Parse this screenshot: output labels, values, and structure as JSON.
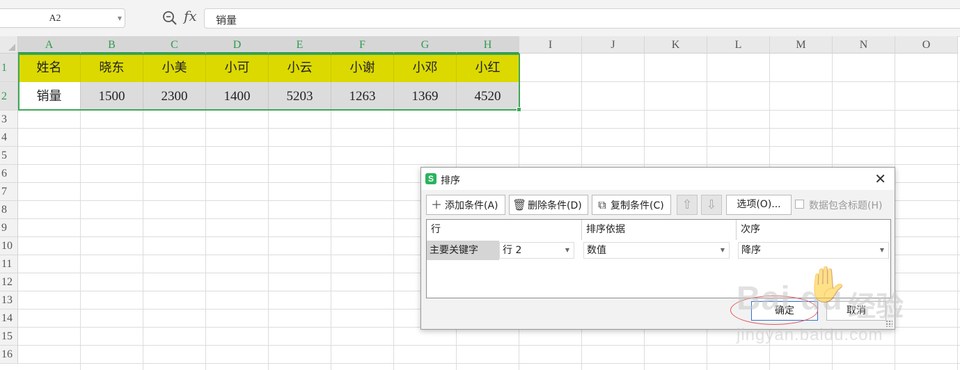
{
  "formula_bar": {
    "name_box": "A2",
    "fx_label": "fx",
    "formula_value": "销量"
  },
  "grid": {
    "columns": [
      "A",
      "B",
      "C",
      "D",
      "E",
      "F",
      "G",
      "H",
      "I",
      "J",
      "K",
      "L",
      "M",
      "N",
      "O"
    ],
    "rows": [
      "1",
      "2",
      "3",
      "4",
      "5",
      "6",
      "7",
      "8",
      "9",
      "10",
      "11",
      "12",
      "13",
      "14",
      "15",
      "16"
    ],
    "row1": [
      "姓名",
      "晓东",
      "小美",
      "小可",
      "小云",
      "小谢",
      "小邓",
      "小红"
    ],
    "row2": [
      "销量",
      "1500",
      "2300",
      "1400",
      "5203",
      "1263",
      "1369",
      "4520"
    ],
    "header_fill_color": "#dcd900",
    "selection_color": "#3ea756"
  },
  "dialog": {
    "app_icon": "S",
    "title": "排序",
    "buttons": {
      "add": "添加条件(A)",
      "delete": "删除条件(D)",
      "copy": "复制条件(C)",
      "move_up_icon": "arrow-up-icon",
      "move_down_icon": "arrow-down-icon",
      "options": "选项(O)...",
      "has_header": "数据包含标题(H)"
    },
    "table_headers": [
      "行",
      "排序依据",
      "次序"
    ],
    "rule": {
      "label": "主要关键字",
      "key": "行 2",
      "sort_on": "数值",
      "order": "降序"
    },
    "ok": "确定",
    "cancel": "取消"
  },
  "watermark": {
    "logo": "Bai du",
    "name": "经验",
    "url": "jingyan.baidu.com"
  }
}
